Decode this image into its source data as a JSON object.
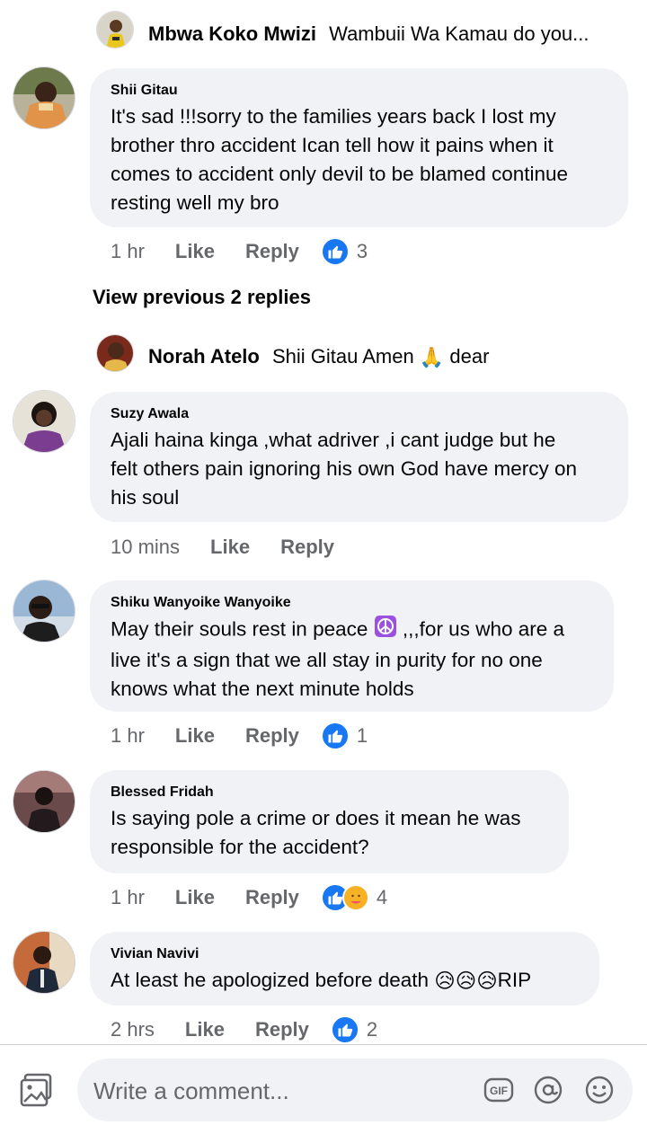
{
  "thread": {
    "top_reply": {
      "name": "Mbwa Koko Mwizi",
      "text": "Wambuii Wa Kamau do you..."
    },
    "view_previous": "View previous 2 replies",
    "mid_reply": {
      "name": "Norah Atelo",
      "text_before": "Shii Gitau Amen",
      "emoji": "🙏",
      "text_after": "dear"
    }
  },
  "comments": [
    {
      "name": "Shii Gitau",
      "lines": [
        "It's sad !!!sorry to the families  years back I lost my",
        "brother thro accident Ican tell how it pains when it",
        "comes to accident only devil to be blamed continue",
        "resting well my bro"
      ],
      "time": "1 hr",
      "like": "Like",
      "reply": "Reply",
      "reaction_count": "3"
    },
    {
      "name": "Suzy Awala",
      "lines": [
        "Ajali haina kinga ,what adriver ,i cant judge but he",
        "felt others pain ignoring his own God have mercy on",
        "his soul"
      ],
      "time": "10 mins",
      "like": "Like",
      "reply": "Reply"
    },
    {
      "name": "Shiku Wanyoike Wanyoike",
      "line1_before": "May their souls rest in peace",
      "line1_after": ",,,for us who are a",
      "lines": [
        "live it's a sign that we all stay in purity for no one",
        "knows what the next minute holds"
      ],
      "time": "1 hr",
      "like": "Like",
      "reply": "Reply",
      "reaction_count": "1"
    },
    {
      "name": "Blessed Fridah",
      "lines": [
        "Is saying pole a crime or does it mean he was",
        "responsible for the accident?"
      ],
      "time": "1 hr",
      "like": "Like",
      "reply": "Reply",
      "reaction_count": "4"
    },
    {
      "name": "Vivian Navivi",
      "text_before": "At least he apologized before death",
      "emojis": "😥😥😥",
      "text_after": "RIP",
      "time": "2 hrs",
      "like": "Like",
      "reply": "Reply",
      "reaction_count": "2"
    }
  ],
  "composer": {
    "placeholder": "Write a comment...",
    "gif_label": "GIF"
  },
  "colors": {
    "accent": "#1877f2",
    "bubble": "#f0f2f5",
    "meta": "#65676b"
  }
}
